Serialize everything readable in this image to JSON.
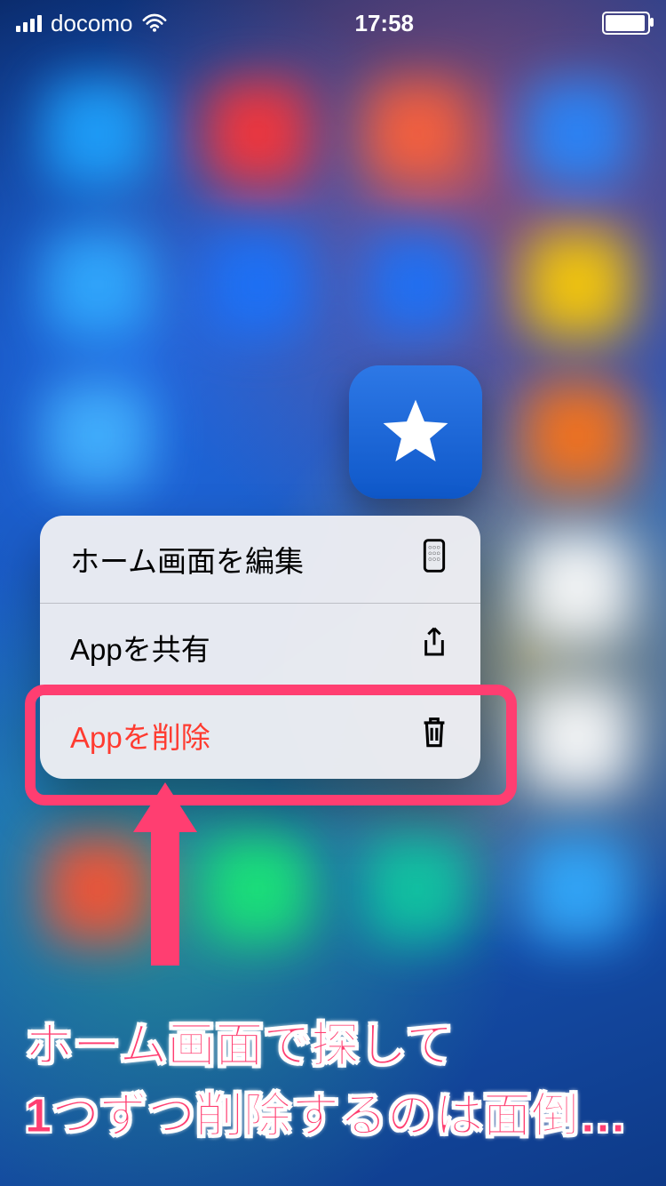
{
  "status": {
    "carrier": "docomo",
    "time": "17:58"
  },
  "app_icon": {
    "name": "star-app"
  },
  "menu": {
    "items": [
      {
        "label": "ホーム画面を編集",
        "icon": "homescreen-edit-icon",
        "danger": false
      },
      {
        "label": "Appを共有",
        "icon": "share-icon",
        "danger": false
      },
      {
        "label": "Appを削除",
        "icon": "trash-icon",
        "danger": true
      }
    ]
  },
  "annotation": {
    "line1": "ホーム画面で探して",
    "line2": "1つずつ削除するのは面倒…"
  },
  "colors": {
    "accent_pink": "#ff3e71",
    "danger_red": "#ff3b30",
    "icon_blue": "#1a63d6"
  }
}
